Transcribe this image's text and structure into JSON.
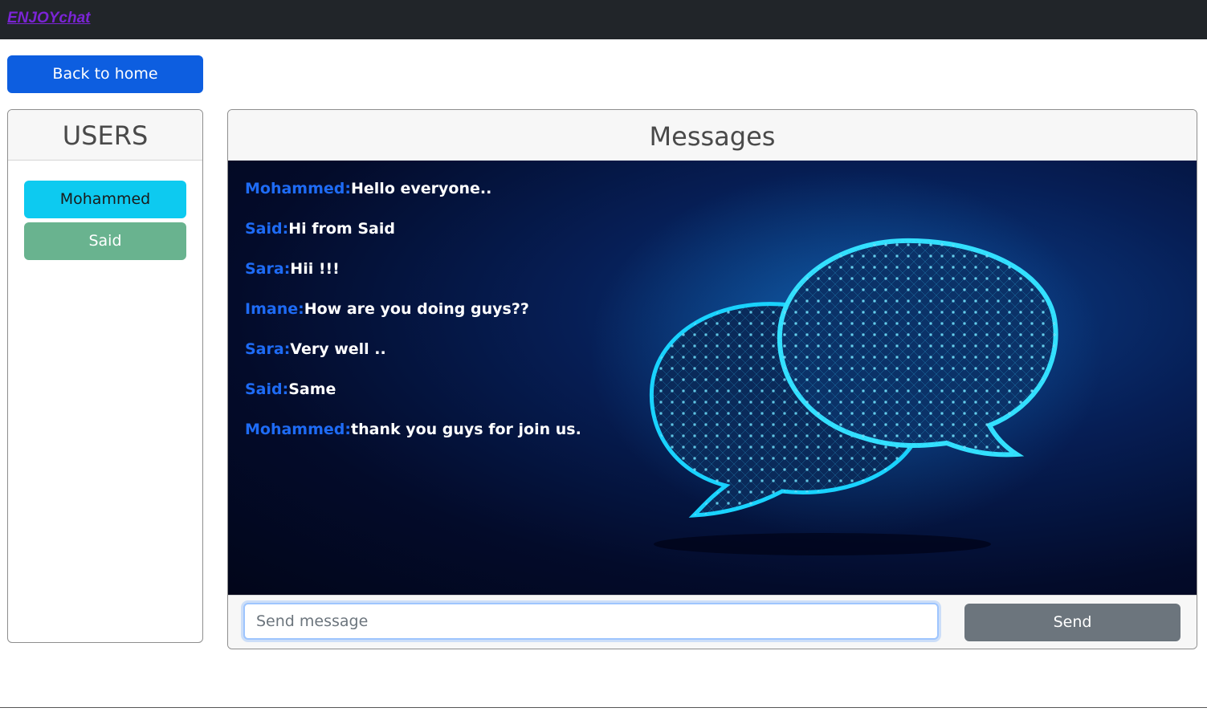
{
  "navbar": {
    "brand": "ENJOYchat",
    "brand_color": "#7b24d6"
  },
  "home_button": {
    "label": "Back to home"
  },
  "users_panel": {
    "title": "USERS",
    "users": [
      {
        "name": "Mohammed",
        "color": "#0dcaf0"
      },
      {
        "name": "Said",
        "color": "#69b38f"
      }
    ]
  },
  "messages_panel": {
    "title": "Messages",
    "background_art": "glowing-chat-bubbles-icon",
    "messages": [
      {
        "user": "Mohammed:",
        "text": "Hello everyone.."
      },
      {
        "user": "Said:",
        "text": "Hi from Said"
      },
      {
        "user": "Sara:",
        "text": "Hii !!!"
      },
      {
        "user": "Imane:",
        "text": "How are you doing guys??"
      },
      {
        "user": "Sara:",
        "text": "Very well .."
      },
      {
        "user": "Said:",
        "text": "Same"
      },
      {
        "user": "Mohammed:",
        "text": "thank you guys for join us."
      }
    ],
    "username_color": "#1e6bf5",
    "text_color": "#ffffff"
  },
  "composer": {
    "value": "",
    "placeholder": "Send message",
    "send_label": "Send"
  }
}
